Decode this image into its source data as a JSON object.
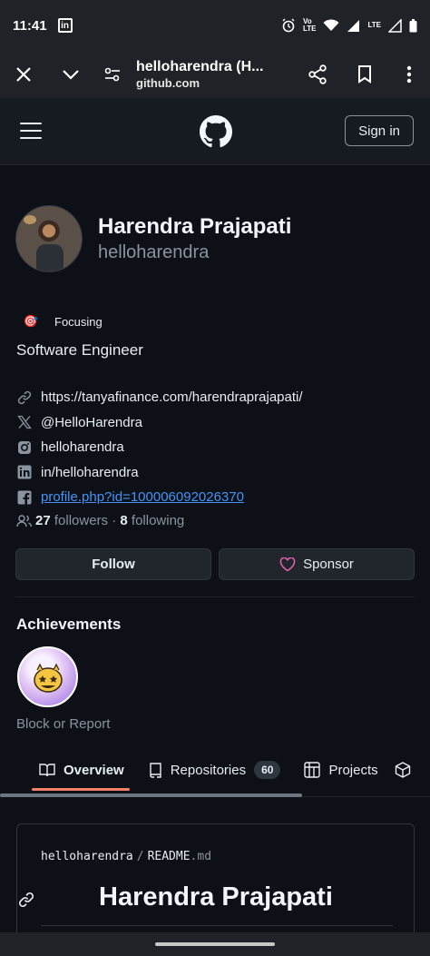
{
  "status_bar": {
    "time": "11:41",
    "linkedin_glyph": "in",
    "lte": "LTE",
    "volte_line1": "Vo",
    "volte_line2": "LTE",
    "icons": [
      "alarm-icon",
      "wifi-icon",
      "signal-icon",
      "battery-icon"
    ]
  },
  "browser": {
    "page_title": "helloharendra (H...",
    "domain": "github.com"
  },
  "github_header": {
    "sign_in": "Sign in"
  },
  "profile": {
    "name": "Harendra Prajapati",
    "login": "helloharendra",
    "status": "Focusing",
    "status_emoji": "🎯",
    "bio": "Software Engineer",
    "website": "https://tanyafinance.com/harendraprajapati/",
    "twitter": "@HelloHarendra",
    "instagram": "helloharendra",
    "linkedin": "in/helloharendra",
    "facebook": "profile.php?id=100006092026370",
    "followers_count": "27",
    "followers_label": "followers",
    "dot": "·",
    "following_count": "8",
    "following_label": "following"
  },
  "actions": {
    "follow": "Follow",
    "sponsor": "Sponsor"
  },
  "achievements": {
    "title": "Achievements",
    "block_report": "Block or Report"
  },
  "tabs": [
    {
      "label": "Overview",
      "icon": "book-icon"
    },
    {
      "label": "Repositories",
      "icon": "repo-icon",
      "count": "60"
    },
    {
      "label": "Projects",
      "icon": "project-icon"
    }
  ],
  "readme": {
    "owner": "helloharendra",
    "separator": "/",
    "file": "README",
    "ext": ".md",
    "heading": "Harendra Prajapati"
  },
  "colors": {
    "accent_underline": "#f78166",
    "link": "#4493f8",
    "sponsor_heart": "#db61a2",
    "background": "#0d1117"
  }
}
